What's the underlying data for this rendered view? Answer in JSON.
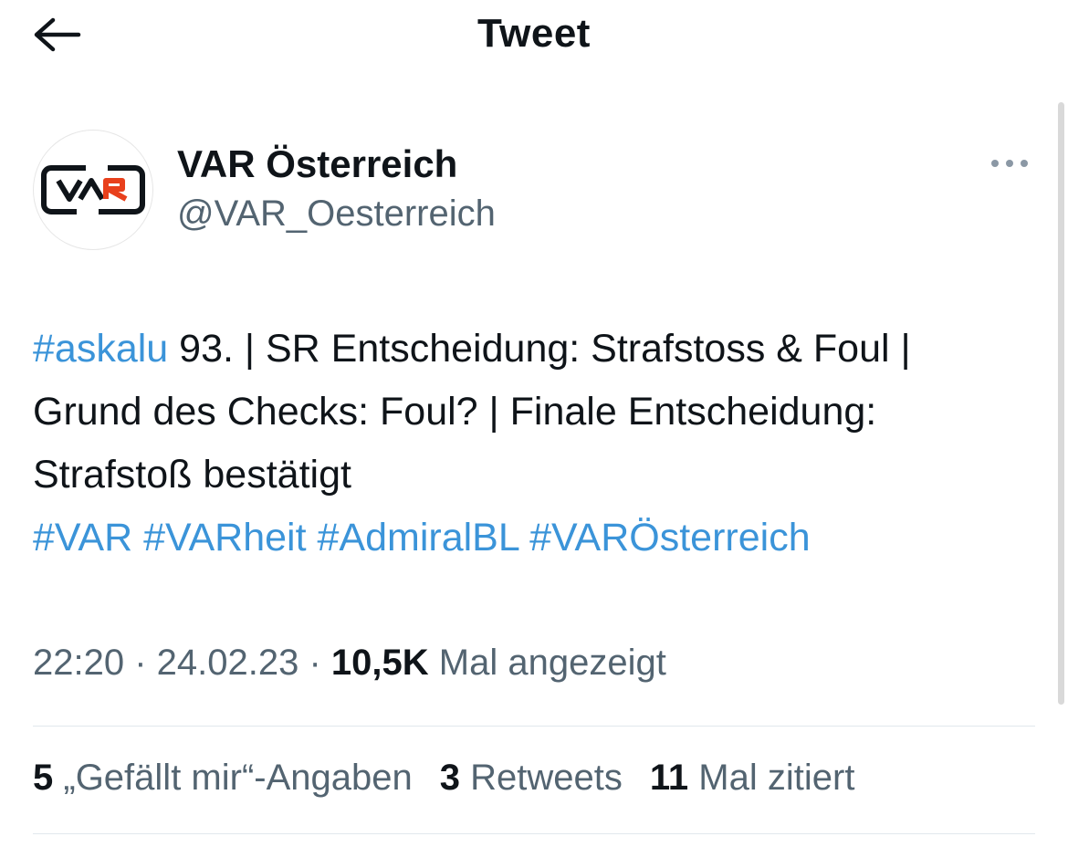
{
  "header": {
    "title": "Tweet",
    "back_icon": "arrow-left-icon"
  },
  "author": {
    "display_name": "VAR Österreich",
    "handle": "@VAR_Oesterreich",
    "avatar_text": "VAR",
    "more_icon": "more-horizontal-icon"
  },
  "tweet": {
    "hashtag_lead": "#askalu",
    "body": " 93. | SR Entscheidung: Strafstoss & Foul | Grund des Checks: Foul? | Finale Entscheidung: Strafstoß bestätigt",
    "hashtags": [
      "#VAR",
      "#VARheit",
      "#AdmiralBL",
      "#VARÖsterreich"
    ]
  },
  "meta": {
    "time": "22:20",
    "separator": " · ",
    "date": "24.02.23",
    "views": "10,5K",
    "views_label": "Mal angezeigt"
  },
  "stats": {
    "likes_count": "5",
    "likes_label": "„Gefällt mir“-Angaben",
    "retweets_count": "3",
    "retweets_label": "Retweets",
    "quotes_count": "11",
    "quotes_label": "Mal zitiert"
  },
  "colors": {
    "hashtag": "#3b94d9",
    "muted": "#536471",
    "text": "#0f1419",
    "avatar_accent": "#e8401c"
  }
}
